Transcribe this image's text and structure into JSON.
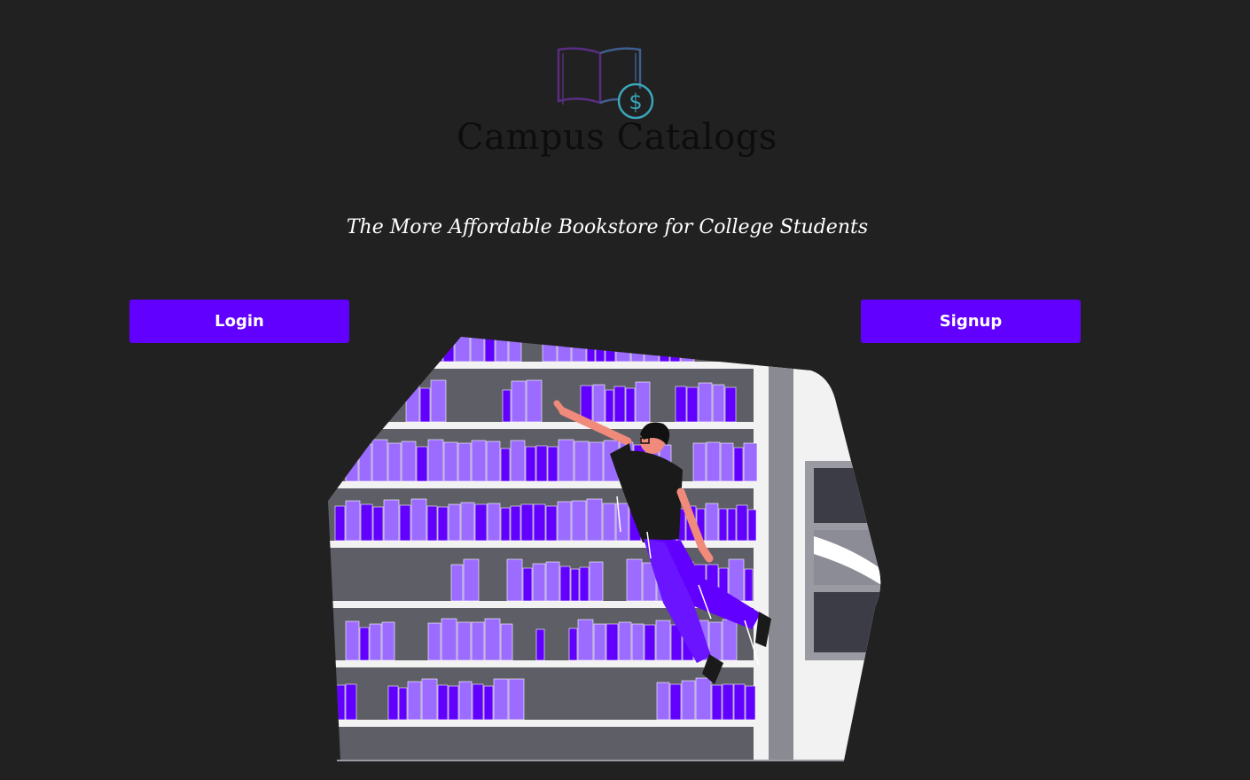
{
  "brand": {
    "name": "Campus Catalogs",
    "logo_icon": "open-book-dollar-icon",
    "colors": {
      "book_outline": "#5a2d82",
      "coin_outline": "#3aa6b9",
      "name_text": "#0d0d0d"
    }
  },
  "hero": {
    "tagline": "The More Affordable Bookstore for College Students"
  },
  "actions": {
    "login_label": "Login",
    "signup_label": "Signup"
  },
  "illustration": {
    "subject": "person-reaching-bookshelf-illustration",
    "colors": {
      "books": "#6200ff",
      "books_light": "#9c6bff",
      "shelf": "#f2f2f2",
      "wall": "#5e5e66"
    }
  },
  "theme": {
    "background": "#212121",
    "accent": "#6200ff",
    "text": "#ffffff"
  }
}
